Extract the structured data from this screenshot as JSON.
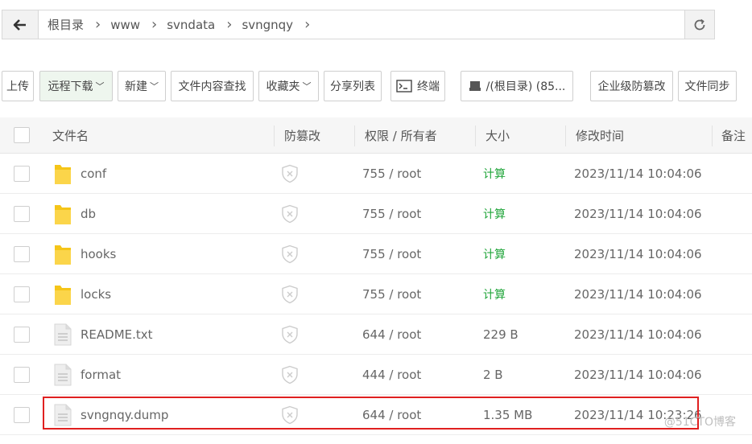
{
  "breadcrumbs": [
    "根目录",
    "www",
    "svndata",
    "svngnqy"
  ],
  "toolbar": {
    "upload": "上传",
    "remote_download": "远程下载",
    "new": "新建",
    "search_content": "文件内容查找",
    "favorites": "收藏夹",
    "share_list": "分享列表",
    "terminal": "终端",
    "disk": "/(根目录) (85...",
    "tamper_enterprise": "企业级防篡改",
    "file_sync": "文件同步"
  },
  "columns": {
    "name": "文件名",
    "tamper": "防篡改",
    "perm": "权限 / 所有者",
    "size": "大小",
    "mtime": "修改时间",
    "note": "备注"
  },
  "rows": [
    {
      "type": "folder",
      "name": "conf",
      "perm": "755 / root",
      "size": "计算",
      "mtime": "2023/11/14 10:04:06"
    },
    {
      "type": "folder",
      "name": "db",
      "perm": "755 / root",
      "size": "计算",
      "mtime": "2023/11/14 10:04:06"
    },
    {
      "type": "folder",
      "name": "hooks",
      "perm": "755 / root",
      "size": "计算",
      "mtime": "2023/11/14 10:04:06"
    },
    {
      "type": "folder",
      "name": "locks",
      "perm": "755 / root",
      "size": "计算",
      "mtime": "2023/11/14 10:04:06"
    },
    {
      "type": "file",
      "name": "README.txt",
      "perm": "644 / root",
      "size": "229 B",
      "mtime": "2023/11/14 10:04:06"
    },
    {
      "type": "file",
      "name": "format",
      "perm": "444 / root",
      "size": "2 B",
      "mtime": "2023/11/14 10:04:06"
    },
    {
      "type": "file",
      "name": "svngnqy.dump",
      "perm": "644 / root",
      "size": "1.35 MB",
      "mtime": "2023/11/14 10:23:26"
    }
  ],
  "watermark": "@51CTO博客",
  "colors": {
    "accent_green": "#20a53a",
    "highlight_red": "#e02020"
  }
}
